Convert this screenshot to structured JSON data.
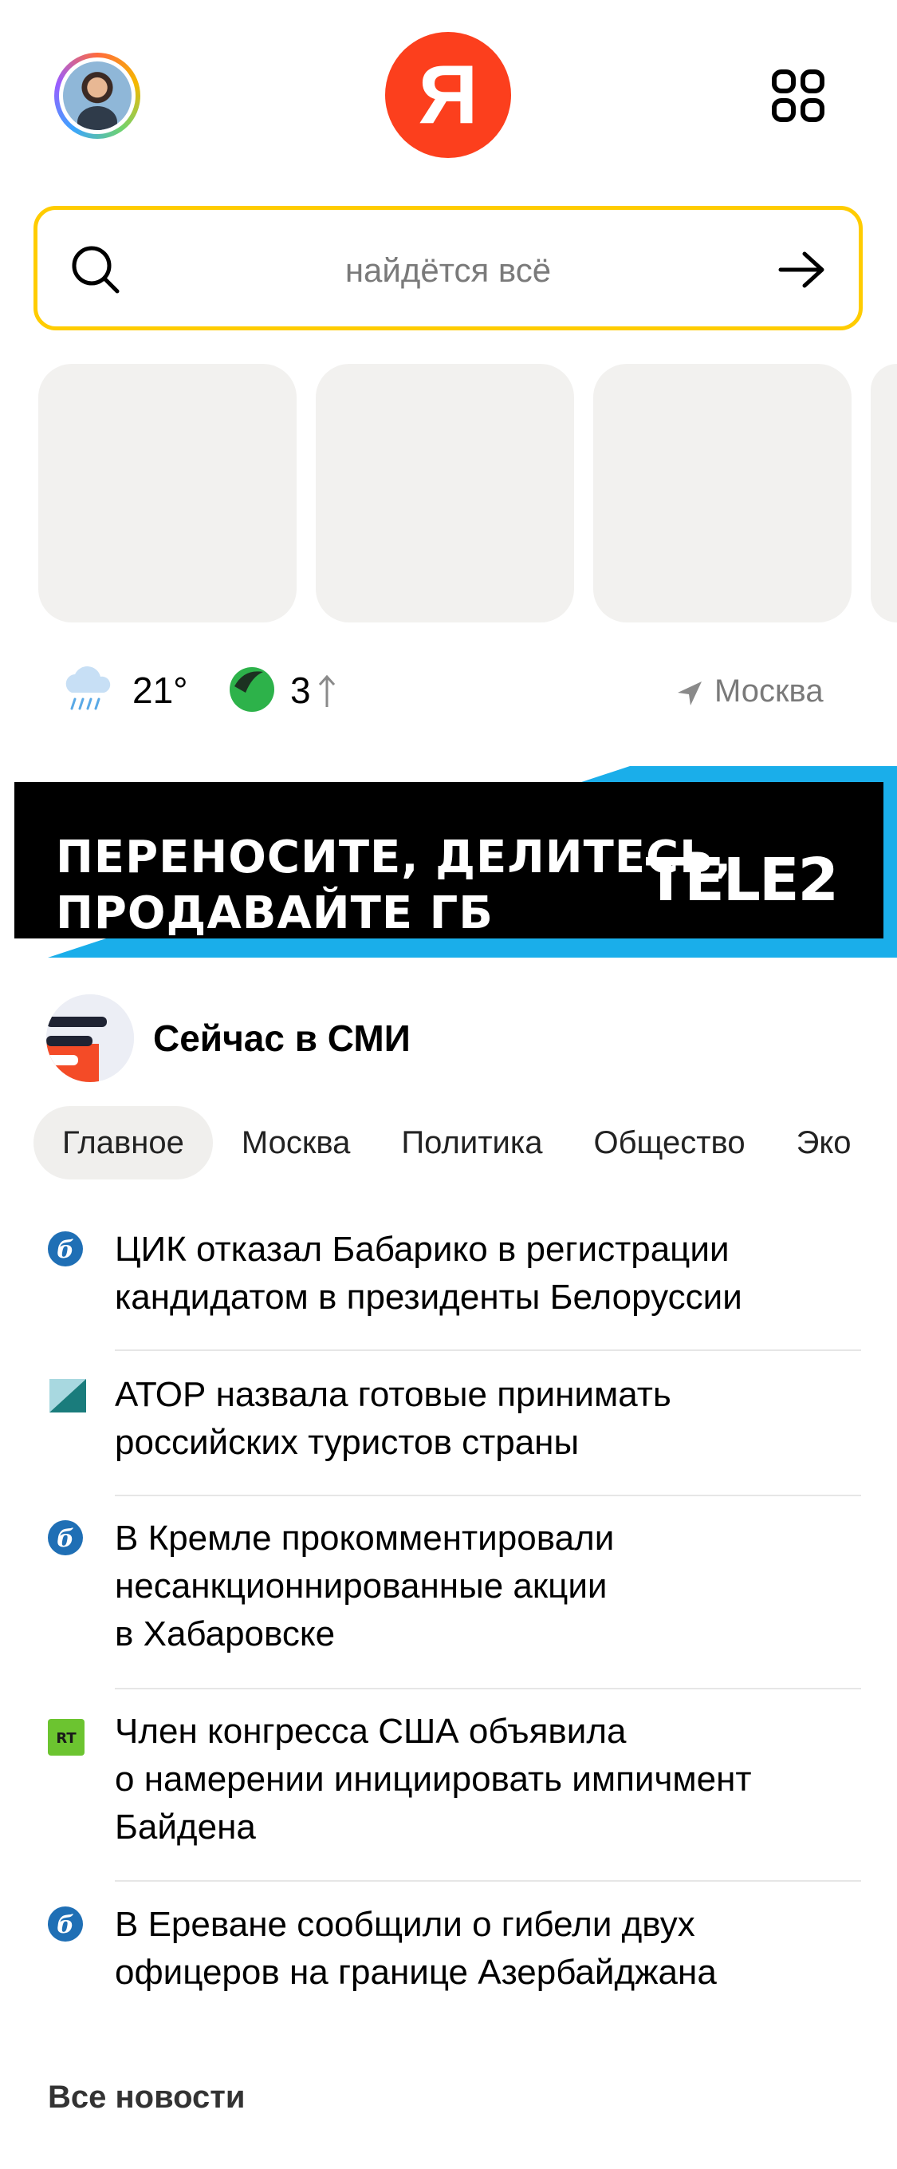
{
  "header": {
    "logo_letter": "Я",
    "avatar_label": "",
    "apps_icon": "grid-icon"
  },
  "search": {
    "placeholder": "найдётся всё",
    "search_icon": "search-icon",
    "go_icon": "arrow-right-icon"
  },
  "info": {
    "temperature": "21°",
    "traffic_score": "3",
    "city": "Москва"
  },
  "banner": {
    "line1": "ПЕРЕНОСИТЕ, ДЕЛИТЕСЬ,",
    "line2": "ПРОДАВАЙТЕ ГБ",
    "brand": "TELE2"
  },
  "news": {
    "title": "Сейчас в СМИ",
    "tabs": [
      "Главное",
      "Москва",
      "Политика",
      "Общество",
      "Эко"
    ],
    "items": [
      {
        "source_icon": "source-rg-icon",
        "lines": [
          "ЦИК отказал Бабарико в регистрации",
          "кандидатом в президенты Белоруссии"
        ]
      },
      {
        "source_icon": "source-ator-icon",
        "lines": [
          "АТОР назвала готовые принимать",
          "российских туристов страны"
        ]
      },
      {
        "source_icon": "source-rg-icon",
        "lines": [
          "В Кремле прокомментировали",
          "несанкционнированные акции",
          "в Хабаровске"
        ]
      },
      {
        "source_icon": "source-rt-icon",
        "lines": [
          "Член конгресса США объявила",
          "о намерении инициировать импичмент",
          "Байдена"
        ]
      },
      {
        "source_icon": "source-rg-icon",
        "lines": [
          "В Ереване сообщили о гибели двух",
          "офицеров на границе Азербайджана"
        ]
      }
    ],
    "all_news": "Все новости"
  },
  "colors": {
    "brand_red": "#fc3f1d",
    "search_border": "#ffcc00",
    "banner_blue": "#1aaeea"
  }
}
